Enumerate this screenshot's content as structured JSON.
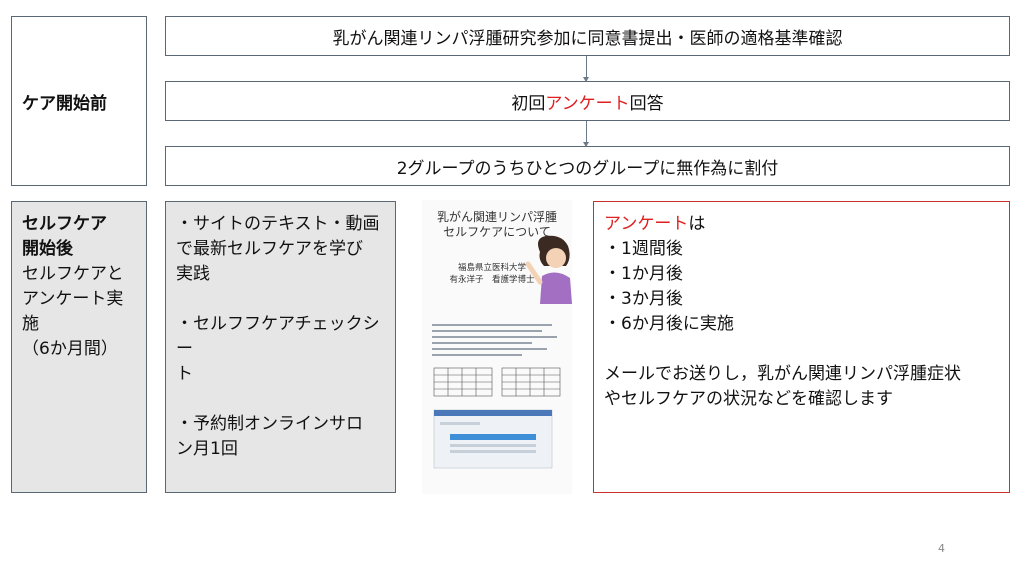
{
  "before": {
    "label": "ケア開始前",
    "steps": [
      {
        "text": "乳がん関連リンパ浮腫研究参加に同意書提出・医師の適格基準確認"
      },
      {
        "before": "初回",
        "highlight": "アンケート",
        "after": "回答"
      },
      {
        "text": "2グループのうちひとつのグループに無作為に割付"
      }
    ]
  },
  "after": {
    "label_bold_1": "セルフケア",
    "label_bold_2": "開始後",
    "label_lines": [
      "セルフケアと",
      "アンケート実",
      "施",
      "（6か月間）"
    ],
    "activities": [
      {
        "lines": [
          "・サイトのテキスト・動画",
          "で最新セルフケアを学び",
          "実践"
        ]
      },
      {
        "lines": [
          "・セルフフケアチェックシー",
          "ト"
        ]
      },
      {
        "lines": [
          "・予約制オンラインサロ",
          "ン月1回"
        ]
      }
    ],
    "document": {
      "title_lines": [
        "乳がん関連リンパ浮腫",
        "セルフケアについて"
      ],
      "sub_lines": [
        "福島県立医科大学",
        "有永洋子　看護学博士"
      ]
    },
    "survey": {
      "title_highlight": "アンケート",
      "title_rest": "は",
      "schedule": [
        "・1週間後",
        "・1か月後",
        "・3か月後",
        "・6か月後に実施"
      ],
      "description_lines": [
        "メールでお送りし，乳がん関連リンパ浮腫症状",
        "やセルフケアの状況などを確認します"
      ]
    }
  },
  "page_number": "4",
  "colors": {
    "highlight": "#e02020",
    "border": "#5a6775",
    "gray_fill": "#e6e6e6",
    "red_border": "#c9302c"
  }
}
